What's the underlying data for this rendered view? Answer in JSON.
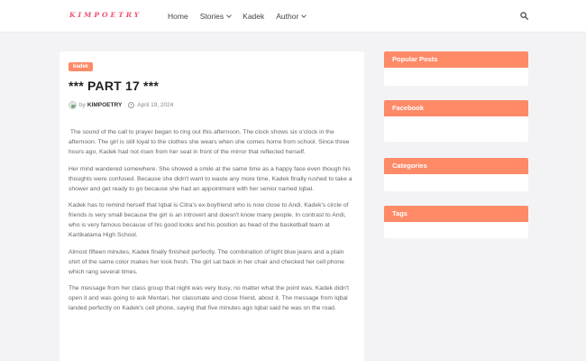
{
  "header": {
    "logo": "KIMPOETRY",
    "nav": [
      {
        "label": "Home",
        "dropdown": false
      },
      {
        "label": "Stories",
        "dropdown": true
      },
      {
        "label": "Kadek",
        "dropdown": false
      },
      {
        "label": "Author",
        "dropdown": true
      }
    ],
    "search_icon": "search-icon"
  },
  "post": {
    "label": "kadek",
    "title": "*** PART 17 ***",
    "meta": {
      "by": "by",
      "author": "KIMPOETRY",
      "date": "April 19, 2024"
    },
    "paragraphs": [
      " The sound of the call to prayer began to ring out this afternoon. The clock shows six o'clock in the afternoon. The girl is still loyal to the clothes she wears when she comes home from school. Since three hours ago, Kadek had not risen from her seat in front of the mirror that reflected herself.",
      "Her mind wandered somewhere. She showed a smile at the same time as a happy face even though his thoughts were confused. Because she didn't want to waste any more time, Kadek finally rushed to take a shower and get ready to go because she had an appointment with her senior named Iqbal.",
      "Kadek has to remind herself that Iqbal is Citra's ex-boyfriend who is now close to Andi. Kadek's circle of friends is very small because the girl is an introvert and doesn't know many people. In contrast to Andi, who is very famous because of his good looks and his position as head of the basketball team at Kartikatama High School.",
      "Almost fifteen minutes, Kadek finally finished perfectly. The combination of light blue jeans and a plain shirt of the same color makes her look fresh. The girl sat back in her chair and checked her cell phone which rang several times.",
      "The message from her class group that night was very busy, no matter what the point was. Kadek didn't open it and was going to ask Mentari, her classmate and close friend, about it. The message from Iqbal landed perfectly on Kadek's cell phone, saying that five minutes ago Iqbal said he was on the road."
    ]
  },
  "sidebar": {
    "widgets": [
      {
        "title": "Popular Posts"
      },
      {
        "title": "Facebook"
      },
      {
        "title": "Categories"
      },
      {
        "title": "Tags"
      }
    ]
  },
  "colors": {
    "accent": "#fe8a67",
    "logo": "#f0506e",
    "background": "#f3f3f5"
  }
}
